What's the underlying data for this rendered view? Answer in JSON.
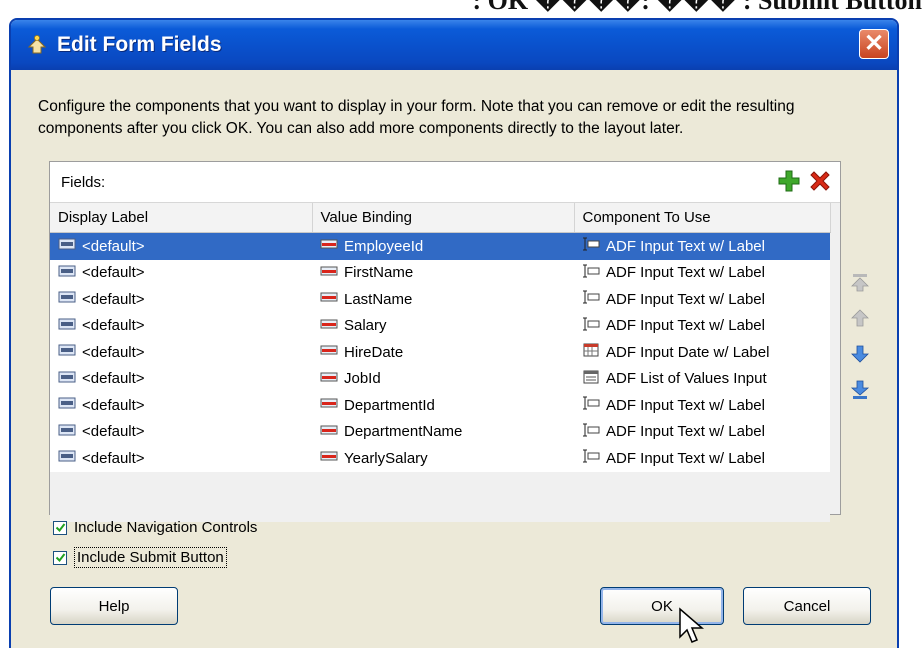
{
  "background": {
    "caption": ": OK ����: ��� : Submit Button"
  },
  "dialog": {
    "title": "Edit Form Fields",
    "close_label": "✕",
    "instructions": "Configure the components that you want to display in your form.  Note that you can remove or edit the resulting components after you click OK.  You can also add more components directly to the layout later."
  },
  "fields": {
    "label": "Fields:",
    "columns": [
      "Display Label",
      "Value Binding",
      "Component To Use"
    ],
    "rows": [
      {
        "display_label": "<default>",
        "value_binding": "EmployeeId",
        "component": "ADF Input Text w/ Label",
        "component_icon": "input-text-icon",
        "selected": true
      },
      {
        "display_label": "<default>",
        "value_binding": "FirstName",
        "component": "ADF Input Text w/ Label",
        "component_icon": "input-text-icon"
      },
      {
        "display_label": "<default>",
        "value_binding": "LastName",
        "component": "ADF Input Text w/ Label",
        "component_icon": "input-text-icon"
      },
      {
        "display_label": "<default>",
        "value_binding": "Salary",
        "component": "ADF Input Text w/ Label",
        "component_icon": "input-text-icon"
      },
      {
        "display_label": "<default>",
        "value_binding": "HireDate",
        "component": "ADF Input Date w/ Label",
        "component_icon": "calendar-icon"
      },
      {
        "display_label": "<default>",
        "value_binding": "JobId",
        "component": "ADF List of Values Input",
        "component_icon": "list-of-values-icon"
      },
      {
        "display_label": "<default>",
        "value_binding": "DepartmentId",
        "component": "ADF Input Text w/ Label",
        "component_icon": "input-text-icon"
      },
      {
        "display_label": "<default>",
        "value_binding": "DepartmentName",
        "component": "ADF Input Text w/ Label",
        "component_icon": "input-text-icon"
      },
      {
        "display_label": "<default>",
        "value_binding": "YearlySalary",
        "component": "ADF Input Text w/ Label",
        "component_icon": "input-text-icon"
      }
    ]
  },
  "options": {
    "include_navigation": {
      "label": "Include Navigation Controls",
      "checked": true
    },
    "include_submit": {
      "label": "Include Submit Button",
      "checked": true
    }
  },
  "buttons": {
    "help": "Help",
    "ok": "OK",
    "cancel": "Cancel"
  },
  "colors": {
    "selection": "#316ac5",
    "title_bar": "#0a50cb",
    "dialog_face": "#ece9d8"
  }
}
